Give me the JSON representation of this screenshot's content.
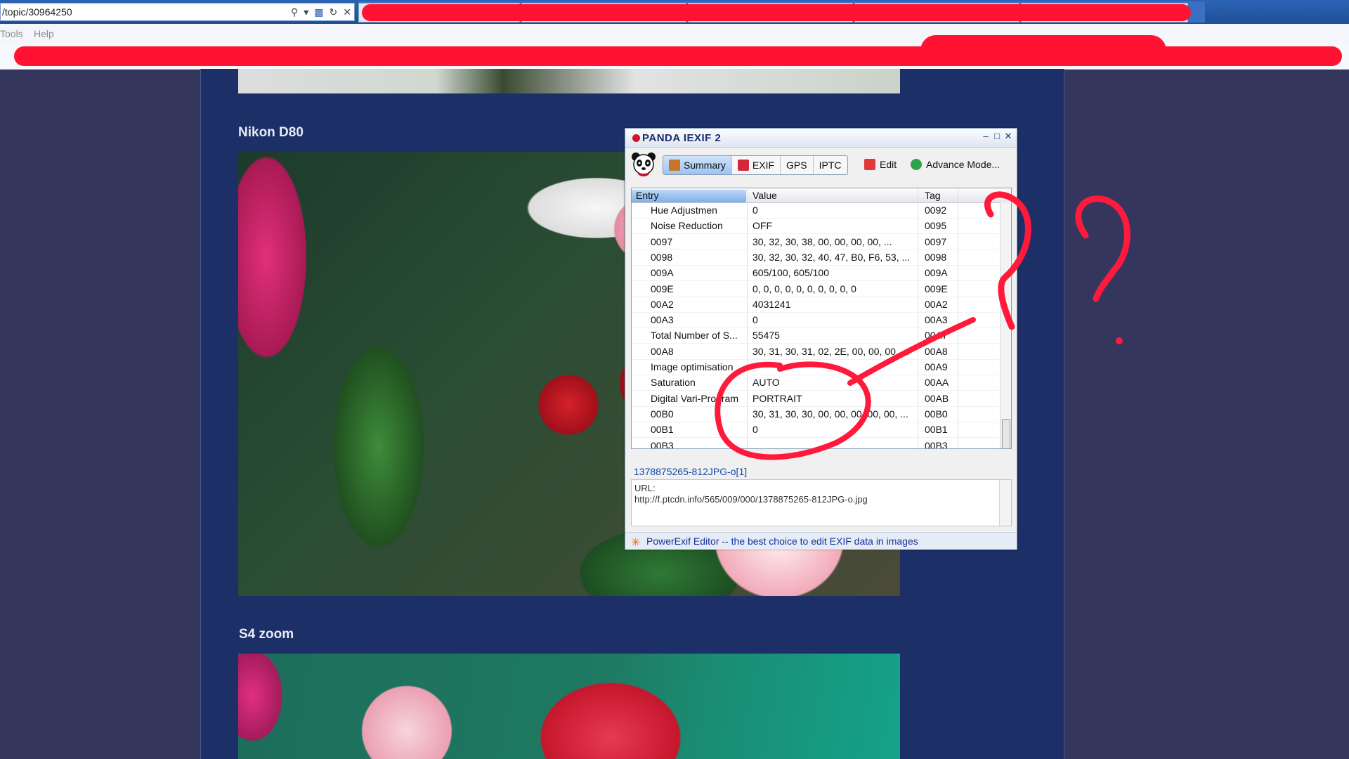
{
  "browser": {
    "url": "/topic/30964250",
    "menu": [
      "Tools",
      "Help"
    ]
  },
  "page": {
    "heading_1": "Nikon D80",
    "heading_2": "S4 zoom"
  },
  "exif_window": {
    "title": "PANDA IEXIF 2",
    "toolbar": {
      "tabs": [
        {
          "label": "Summary",
          "active": true
        },
        {
          "label": "EXIF",
          "active": false
        },
        {
          "label": "GPS",
          "active": false
        },
        {
          "label": "IPTC",
          "active": false
        }
      ],
      "edit_label": "Edit",
      "advance_label": "Advance Mode..."
    },
    "columns": {
      "entry": "Entry",
      "value": "Value",
      "tag": "Tag"
    },
    "rows": [
      {
        "entry": "Hue Adjustmen",
        "value": "0",
        "tag": "0092"
      },
      {
        "entry": "Noise Reduction",
        "value": "OFF",
        "tag": "0095"
      },
      {
        "entry": "0097",
        "value": "30, 32, 30, 38, 00, 00, 00, 00, ...",
        "tag": "0097"
      },
      {
        "entry": "0098",
        "value": "30, 32, 30, 32, 40, 47, B0, F6, 53, ...",
        "tag": "0098"
      },
      {
        "entry": "009A",
        "value": "605/100, 605/100",
        "tag": "009A"
      },
      {
        "entry": "009E",
        "value": "0, 0, 0, 0, 0, 0, 0, 0, 0, 0",
        "tag": "009E"
      },
      {
        "entry": "00A2",
        "value": "4031241",
        "tag": "00A2"
      },
      {
        "entry": "00A3",
        "value": "0",
        "tag": "00A3"
      },
      {
        "entry": "Total Number of S...",
        "value": "55475",
        "tag": "00A7"
      },
      {
        "entry": "00A8",
        "value": "30, 31, 30, 31, 02, 2E, 00, 00, 00, ...",
        "tag": "00A8"
      },
      {
        "entry": "Image optimisation",
        "value": "",
        "tag": "00A9"
      },
      {
        "entry": "Saturation",
        "value": "AUTO",
        "tag": "00AA"
      },
      {
        "entry": "Digital Vari-Program",
        "value": "PORTRAIT",
        "tag": "00AB"
      },
      {
        "entry": "00B0",
        "value": "30, 31, 30, 30, 00, 00, 00, 00, 00, ...",
        "tag": "00B0"
      },
      {
        "entry": "00B1",
        "value": "0",
        "tag": "00B1"
      },
      {
        "entry": "00B3",
        "value": "",
        "tag": "00B3"
      }
    ],
    "filename": "1378875265-812JPG-o[1]",
    "url_label": "URL:",
    "url_value": "http://f.ptcdn.info/565/009/000/1378875265-812JPG-o.jpg",
    "footer": "PowerExif Editor -- the best choice to edit EXIF data in images"
  },
  "colors": {
    "annotation_red": "#ff1a3c",
    "page_bg": "#35365e",
    "content_bg": "#1c2f67"
  }
}
